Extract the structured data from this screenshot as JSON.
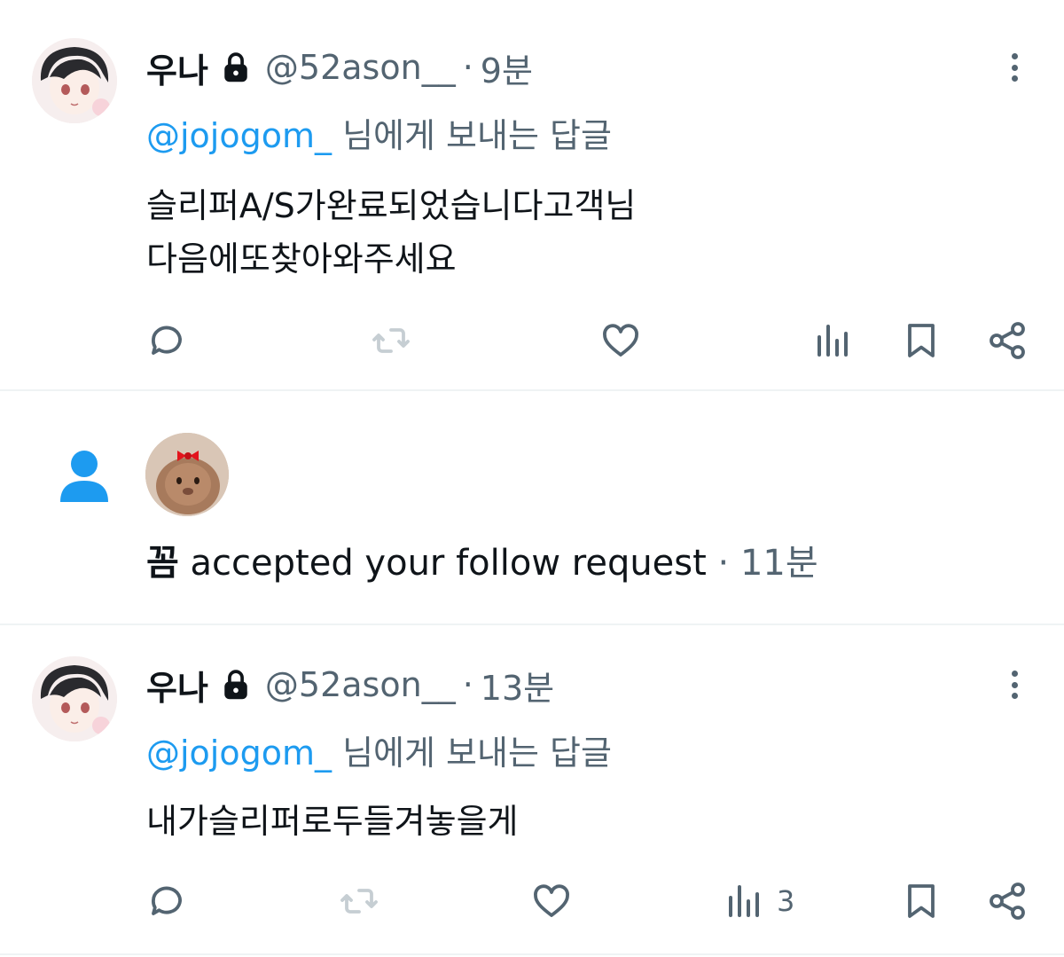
{
  "tweets": [
    {
      "display_name": "우나",
      "handle": "@52ason__",
      "separator": "·",
      "time": "9분",
      "reply_mention": "@jojogom_",
      "reply_suffix": " 님에게 보내는 답글",
      "body_lines": [
        "슬리퍼A/S가완료되었습니다고객님",
        "다음에또찾아와주세요"
      ],
      "views_count": ""
    },
    {
      "display_name": "우나",
      "handle": "@52ason__",
      "separator": "·",
      "time": "13분",
      "reply_mention": "@jojogom_",
      "reply_suffix": " 님에게 보내는 답글",
      "body_lines": [
        "내가슬리퍼로두들겨놓을게"
      ],
      "views_count": "3"
    }
  ],
  "notification": {
    "actor": "꼼",
    "text": " accepted your follow request",
    "separator": "·",
    "time": "11분"
  },
  "icons": {
    "reply": "reply-icon",
    "retweet": "retweet-icon",
    "like": "heart-icon",
    "views": "views-icon",
    "bookmark": "bookmark-icon",
    "share": "share-icon",
    "lock": "lock-icon",
    "more": "more-icon",
    "person": "person-icon"
  },
  "colors": {
    "text": "#0f1419",
    "secondary": "#536471",
    "accent": "#1d9bf0",
    "divider": "#eff3f4"
  }
}
